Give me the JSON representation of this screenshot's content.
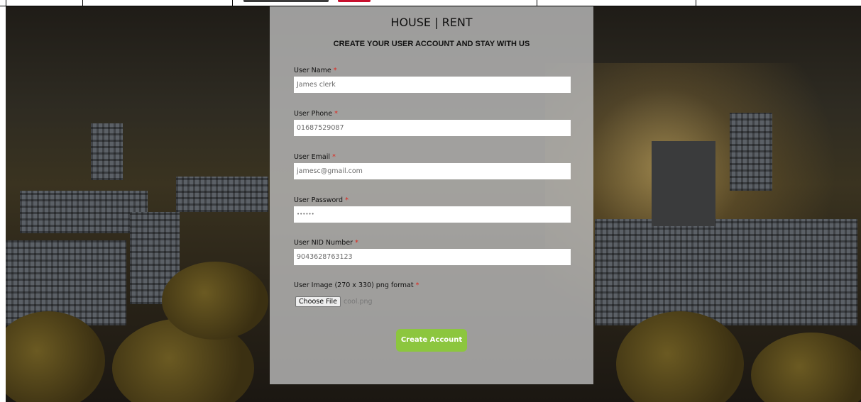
{
  "header": {
    "brand": "HOUSE | RENT",
    "subtitle": "CREATE YOUR USER ACCOUNT AND STAY WITH US"
  },
  "form": {
    "required_marker": "*",
    "fields": [
      {
        "label": "User Name",
        "value": "James clerk"
      },
      {
        "label": "User Phone",
        "value": "01687529087"
      },
      {
        "label": "User Email",
        "value": "jamesc@gmail.com"
      },
      {
        "label": "User Password",
        "value": "••••••"
      },
      {
        "label": "User NID Number",
        "value": "9043628763123"
      }
    ],
    "image": {
      "label": "User Image (270 x 330) png format",
      "button_label": "Choose File",
      "file_name": "cool.png"
    },
    "submit_label": "Create Account"
  },
  "colors": {
    "accent_button": "#8cc63e",
    "required": "#e2231a",
    "panel": "#b9b9b9"
  }
}
